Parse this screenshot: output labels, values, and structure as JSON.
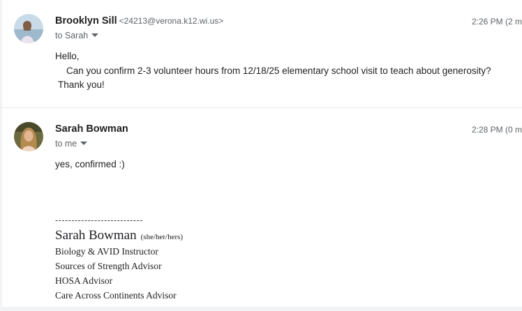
{
  "messages": [
    {
      "sender_name": "Brooklyn Sill",
      "sender_email": "<24213@verona.k12.wi.us>",
      "recipient_label": "to Sarah",
      "time": "2:26 PM (2 m",
      "body": {
        "line1": "Hello,",
        "line2": "Can you confirm 2-3 volunteer hours from 12/18/25 elementary school visit to teach about generosity?",
        "line3": "Thank you!"
      },
      "avatar_icon": "profile-photo-icon"
    },
    {
      "sender_name": "Sarah Bowman",
      "recipient_label": "to me",
      "time": "2:28 PM (0 m",
      "body": {
        "line1": "yes, confirmed :)"
      },
      "avatar_icon": "profile-photo-icon",
      "signature": {
        "dashes": "---------------------------",
        "name": "Sarah Bowman",
        "pronouns": "(she/her/hers)",
        "lines": [
          "Biology & AVID Instructor",
          "Sources of Strength Advisor",
          "HOSA Advisor",
          "Care Across Continents Advisor"
        ]
      }
    }
  ],
  "icons": {
    "recipient_expand": "chevron-down-icon"
  },
  "colors": {
    "text": "#202124",
    "muted": "#5f6368",
    "divider": "#e6e6e6"
  }
}
